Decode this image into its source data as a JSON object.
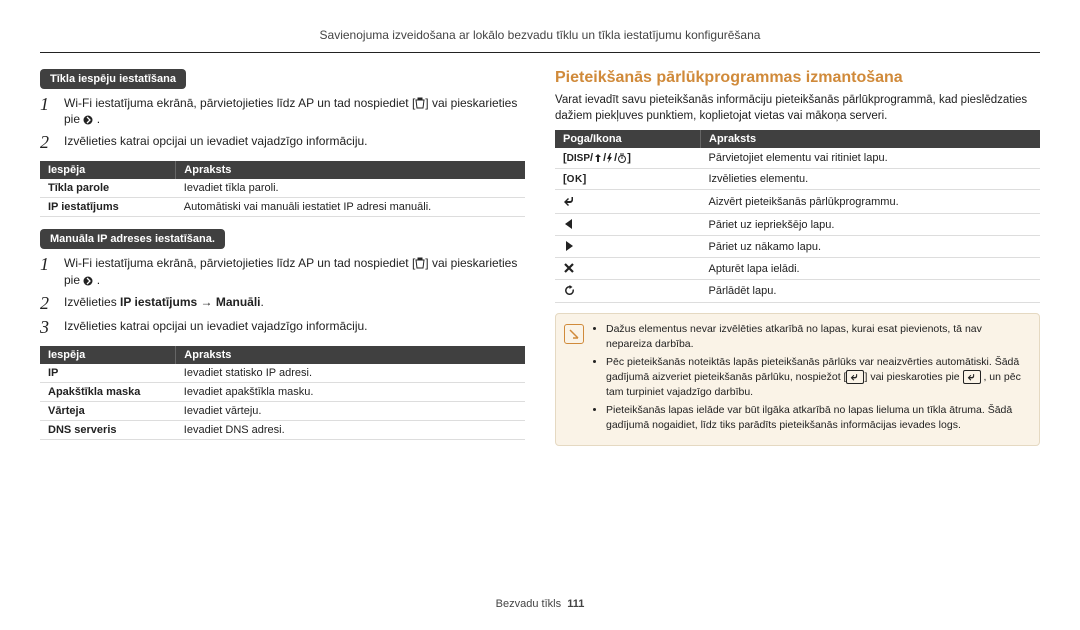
{
  "page_heading": "Savienojuma izveidošana ar lokālo bezvadu tīklu un tīkla iestatījumu konfigurēšana",
  "footer_section": "Bezvadu tīkls",
  "footer_page": "111",
  "left": {
    "pill1": "Tīkla iespēju iestatīšana",
    "s1_step1_line1": "Wi-Fi iestatījuma ekrānā, pārvietojieties līdz AP un tad nospiediet",
    "s1_step1_line2": " vai pieskarieties pie ",
    "s1_step2": "Izvēlieties katrai opcijai un ievadiet vajadzīgo informāciju.",
    "table1_h1": "Iespēja",
    "table1_h2": "Apraksts",
    "table1_r1c1": "Tīkla parole",
    "table1_r1c2": "Ievadiet tīkla paroli.",
    "table1_r2c1": "IP iestatījums",
    "table1_r2c2": "Automātiski vai manuāli iestatiet IP adresi manuāli.",
    "pill2": "Manuāla IP adreses iestatīšana.",
    "s2_step1_line1": "Wi-Fi iestatījuma ekrānā, pārvietojieties līdz AP un tad nospiediet",
    "s2_step1_line2": " vai pieskarieties pie ",
    "s2_step2a": "Izvēlieties ",
    "s2_step2b": "IP iestatījums → Manuāli",
    "s2_step3": "Izvēlieties katrai opcijai un ievadiet vajadzīgo informāciju.",
    "table2_h1": "Iespēja",
    "table2_h2": "Apraksts",
    "table2_r1c1": "IP",
    "table2_r1c2": "Ievadiet statisko IP adresi.",
    "table2_r2c1": "Apakštīkla maska",
    "table2_r2c2": "Ievadiet apakštīkla masku.",
    "table2_r3c1": "Vārteja",
    "table2_r3c2": "Ievadiet vārteju.",
    "table2_r4c1": "DNS serveris",
    "table2_r4c2": "Ievadiet DNS adresi."
  },
  "right": {
    "heading": "Pieteikšanās pārlūkprogrammas izmantošana",
    "lead": "Varat ievadīt savu pieteikšanās informāciju pieteikšanās pārlūkprogrammā, kad pieslēdzaties dažiem piekļuves punktiem, koplietojat vietas vai mākoņa serveri.",
    "btns_h1": "Poga/Ikona",
    "btns_h2": "Apraksts",
    "row_disp_label": "DISP",
    "row_disp_desc": "Pārvietojiet elementu vai ritiniet lapu.",
    "row_ok_label": "OK",
    "row_ok_desc": "Izvēlieties elementu.",
    "row_back_desc": "Aizvērt pieteikšanās pārlūkprogrammu.",
    "row_left_desc": "Pāriet uz iepriekšējo lapu.",
    "row_right_desc": "Pāriet uz nākamo lapu.",
    "row_close_desc": "Apturēt lapa ielādi.",
    "row_reload_desc": "Pārlādēt lapu.",
    "note1": "Dažus elementus nevar izvēlēties atkarībā no lapas, kurai esat pievienots, tā nav nepareiza darbība.",
    "note2a": "Pēc pieteikšanās noteiktās lapās pieteikšanās pārlūks var neaizvērties automātiski. Šādā gadījumā aizveriet pieteikšanās pārlūku, nospiežot [",
    "note2b": "] vai pieskaroties pie  ",
    "note2c": " , un pēc tam turpiniet vajadzīgo darbību.",
    "note3": "Pieteikšanās lapas ielāde var būt ilgāka atkarībā no lapas lieluma un tīkla ātruma. Šādā gadījumā nogaidiet, līdz tiks parādīts pieteikšanās informācijas ievades logs."
  }
}
